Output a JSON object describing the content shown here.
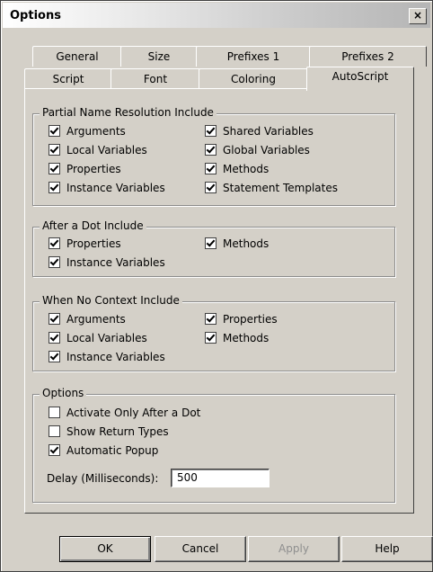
{
  "window": {
    "title": "Options",
    "close_glyph": "×"
  },
  "tabs_back": [
    "General",
    "Size",
    "Prefixes 1",
    "Prefixes 2"
  ],
  "tabs_front": [
    "Script",
    "Font",
    "Coloring",
    "AutoScript"
  ],
  "active_tab": "AutoScript",
  "groups": {
    "partial": {
      "legend": "Partial Name Resolution Include",
      "items": [
        {
          "label": "Arguments",
          "checked": true
        },
        {
          "label": "Local Variables",
          "checked": true
        },
        {
          "label": "Properties",
          "checked": true
        },
        {
          "label": "Instance Variables",
          "checked": true
        },
        {
          "label": "Shared Variables",
          "checked": true
        },
        {
          "label": "Global Variables",
          "checked": true
        },
        {
          "label": "Methods",
          "checked": true
        },
        {
          "label": "Statement Templates",
          "checked": true
        }
      ]
    },
    "after_dot": {
      "legend": "After a Dot Include",
      "items": [
        {
          "label": "Properties",
          "checked": true
        },
        {
          "label": "Instance Variables",
          "checked": true
        },
        {
          "label": "Methods",
          "checked": true
        }
      ]
    },
    "no_context": {
      "legend": "When No Context Include",
      "items": [
        {
          "label": "Arguments",
          "checked": true
        },
        {
          "label": "Local Variables",
          "checked": true
        },
        {
          "label": "Instance Variables",
          "checked": true
        },
        {
          "label": "Properties",
          "checked": true
        },
        {
          "label": "Methods",
          "checked": true
        }
      ]
    },
    "options": {
      "legend": "Options",
      "items": [
        {
          "label": "Activate Only After a Dot",
          "checked": false
        },
        {
          "label": "Show Return Types",
          "checked": false
        },
        {
          "label": "Automatic Popup",
          "checked": true
        }
      ],
      "delay_label": "Delay (Milliseconds):",
      "delay_value": "500"
    }
  },
  "buttons": {
    "ok": "OK",
    "cancel": "Cancel",
    "apply": "Apply",
    "help": "Help"
  }
}
